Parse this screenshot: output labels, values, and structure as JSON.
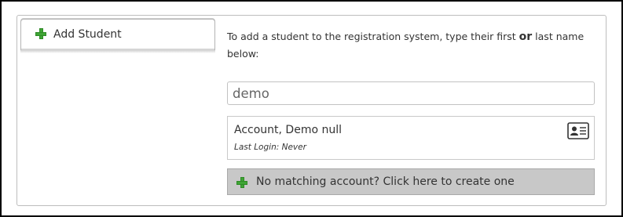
{
  "tabs": [
    {
      "label": "Add Student",
      "icon": "plus-icon",
      "active": true
    }
  ],
  "intro": {
    "text_before": "To add a student to the registration system, type their first ",
    "emphasis": "or",
    "text_after": " last name below:"
  },
  "search": {
    "value": "demo",
    "placeholder": ""
  },
  "results": [
    {
      "name": "Account, Demo null",
      "last_login_label": "Last Login: Never",
      "icon": "id-card-icon"
    }
  ],
  "create_account": {
    "label": "No matching account? Click here to create one",
    "icon": "plus-icon"
  },
  "colors": {
    "plus_green": "#3fa535",
    "create_bar_bg": "#c8c8c8",
    "border": "#bdbdbd"
  }
}
